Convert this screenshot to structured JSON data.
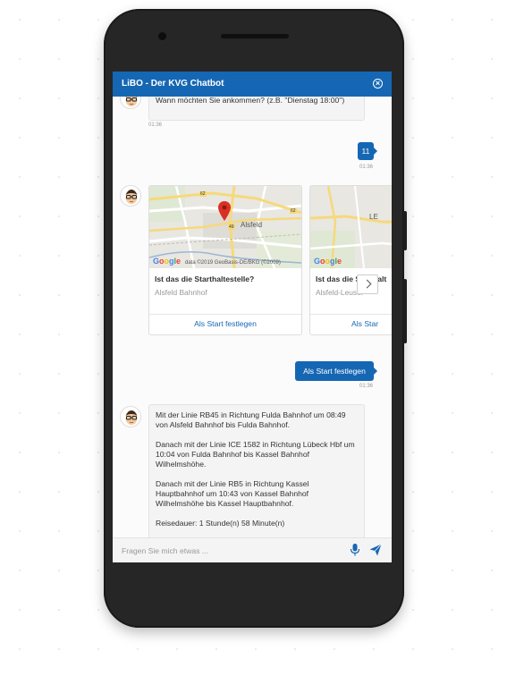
{
  "header": {
    "title": "LiBO - Der KVG Chatbot",
    "close_glyph": "×"
  },
  "messages": {
    "bot_question": "Wann möchten Sie ankommen? (z.B. \"Dienstag 18:00\")",
    "bot_question_time": "01:36",
    "user_answer": "11",
    "user_answer_time": "01:36",
    "user_choice": "Als Start festlegen",
    "user_choice_time": "01:36",
    "route": [
      "Mit der Linie RB45 in Richtung Fulda Bahnhof um 08:49 von Alsfeld Bahnhof bis Fulda Bahnhof.",
      "Danach mit der Linie ICE 1582 in Richtung Lübeck Hbf um 10:04 von Fulda Bahnhof bis Kassel Bahnhof Wilhelmshöhe.",
      "Danach mit der Linie RB5 in Richtung Kassel Hauptbahnhof um 10:43 von Kassel Bahnhof Wilhelmshöhe bis Kassel Hauptbahnhof.",
      "Reisedauer: 1 Stunde(n) 58 Minute(n)"
    ]
  },
  "cards": [
    {
      "title": "Ist das die Starthaltestelle?",
      "subtitle": "Alsfeld Bahnhof",
      "action": "Als Start festlegen",
      "map_town": "Alsfeld",
      "map_roads": [
        "62",
        "62",
        "49"
      ],
      "attribution": "data ©2019 GeoBasis-DE/BKG (©2009)"
    },
    {
      "title": "Ist das die Starthalt",
      "subtitle": "Alsfeld-Leusel",
      "action": "Als Star",
      "map_town": "LE"
    }
  ],
  "google_logo": [
    "G",
    "o",
    "o",
    "g",
    "l",
    "e"
  ],
  "input": {
    "placeholder": "Fragen Sie mich etwas ..."
  },
  "icons": {
    "close": "close-icon",
    "mic": "microphone-icon",
    "send": "send-icon",
    "next": "chevron-right-icon",
    "avatar": "bot-avatar"
  },
  "colors": {
    "primary": "#1567b4",
    "bubble_bg": "#f4f4f4",
    "marker": "#d93025"
  }
}
